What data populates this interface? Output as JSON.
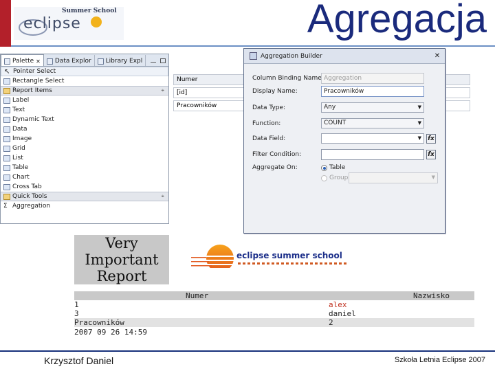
{
  "slide": {
    "title": "Agregacja",
    "logo_text": "eclipse",
    "logo_subtitle": "Summer School",
    "accent": "#b3202a",
    "title_color": "#1a2a7c"
  },
  "palette": {
    "tabs": [
      "Palette",
      "Data Explor",
      "Library Expl"
    ],
    "items": [
      {
        "label": "Pointer Select",
        "icon": "pointer-icon",
        "kind": "item"
      },
      {
        "label": "Rectangle Select",
        "icon": "marquee-icon",
        "kind": "item"
      },
      {
        "label": "Report Items",
        "icon": "folder-icon",
        "kind": "header"
      },
      {
        "label": "Label",
        "icon": "label-icon",
        "kind": "item"
      },
      {
        "label": "Text",
        "icon": "text-icon",
        "kind": "item"
      },
      {
        "label": "Dynamic Text",
        "icon": "dynamic-text-icon",
        "kind": "item"
      },
      {
        "label": "Data",
        "icon": "data-icon",
        "kind": "item"
      },
      {
        "label": "Image",
        "icon": "image-icon",
        "kind": "item"
      },
      {
        "label": "Grid",
        "icon": "grid-icon",
        "kind": "item"
      },
      {
        "label": "List",
        "icon": "list-icon",
        "kind": "item"
      },
      {
        "label": "Table",
        "icon": "table-icon",
        "kind": "item"
      },
      {
        "label": "Chart",
        "icon": "chart-icon",
        "kind": "item"
      },
      {
        "label": "Cross Tab",
        "icon": "crosstab-icon",
        "kind": "item"
      },
      {
        "label": "Quick Tools",
        "icon": "folder-icon",
        "kind": "header"
      },
      {
        "label": "Aggregation",
        "icon": "sigma-icon",
        "kind": "item"
      }
    ]
  },
  "layout_table": {
    "rows": [
      [
        "Numer",
        ""
      ],
      [
        "[id]",
        ""
      ],
      [
        "Pracowników",
        ""
      ]
    ]
  },
  "dialog": {
    "title": "Aggregation Builder",
    "fields": {
      "column_binding_name_label": "Column Binding Name:",
      "column_binding_name_value": "Aggregation",
      "display_name_label": "Display Name:",
      "display_name_value": "Pracowników",
      "data_type_label": "Data Type:",
      "data_type_value": "Any",
      "function_label": "Function:",
      "function_value": "COUNT",
      "data_field_label": "Data Field:",
      "data_field_value": "",
      "filter_condition_label": "Filter Condition:",
      "filter_condition_value": "",
      "aggregate_on_label": "Aggregate On:",
      "aggregate_on_table": "Table",
      "aggregate_on_group": "Group",
      "aggregate_on_selected": "Table"
    },
    "fx_label": "fx"
  },
  "report": {
    "banner_lines": [
      "Very",
      "Important",
      "Report"
    ],
    "logo_text": "eclipse summer school",
    "table": {
      "headers": [
        "Numer",
        "Nazwisko"
      ],
      "rows": [
        [
          "1",
          "alex"
        ],
        [
          "3",
          "daniel"
        ]
      ],
      "aggregate": [
        "Pracowników",
        "2"
      ]
    },
    "timestamp": "2007 09 26 14:59"
  },
  "footer": {
    "left": "Krzysztof Daniel",
    "right": "Szkoła Letnia Eclipse 2007"
  }
}
